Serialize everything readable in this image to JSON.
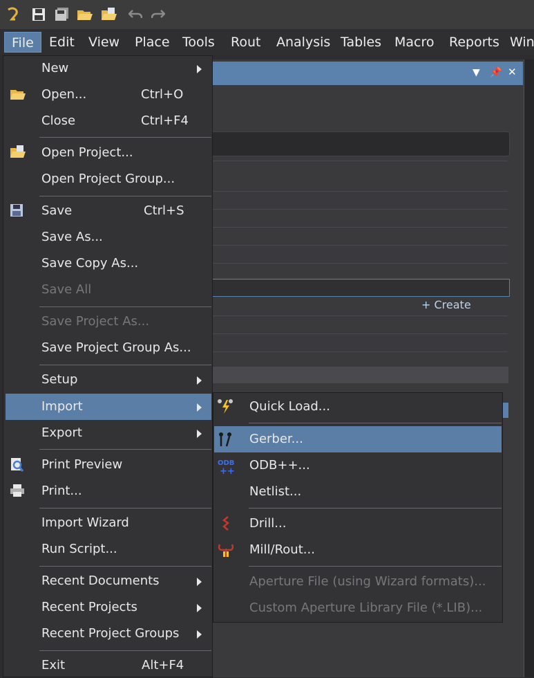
{
  "menubar": {
    "items": [
      "File",
      "Edit",
      "View",
      "Place",
      "Tools",
      "Rout",
      "Analysis",
      "Tables",
      "Macro",
      "Reports",
      "Win"
    ]
  },
  "panel": {
    "create_label": "+ Create"
  },
  "file_menu": {
    "new": "New",
    "open": "Open...",
    "open_sc": "Ctrl+O",
    "close": "Close",
    "close_sc": "Ctrl+F4",
    "open_project": "Open Project...",
    "open_project_group": "Open Project Group...",
    "save": "Save",
    "save_sc": "Ctrl+S",
    "save_as": "Save As...",
    "save_copy_as": "Save Copy As...",
    "save_all": "Save All",
    "save_project_as": "Save Project As...",
    "save_project_group_as": "Save Project Group As...",
    "setup": "Setup",
    "import": "Import",
    "export": "Export",
    "print_preview": "Print Preview",
    "print": "Print...",
    "import_wizard": "Import Wizard",
    "run_script": "Run Script...",
    "recent_documents": "Recent Documents",
    "recent_projects": "Recent Projects",
    "recent_project_groups": "Recent Project Groups",
    "exit": "Exit",
    "exit_sc": "Alt+F4"
  },
  "import_menu": {
    "quick_load": "Quick Load...",
    "gerber": "Gerber...",
    "odb": "ODB++...",
    "netlist": "Netlist...",
    "drill": "Drill...",
    "mill_rout": "Mill/Rout...",
    "aperture_file": "Aperture File (using Wizard formats)...",
    "custom_aperture": "Custom Aperture Library File (*.LIB)..."
  },
  "colors": {
    "highlight": "#5a7ea5",
    "menu_bg": "#333336",
    "disabled_text": "#77777a"
  }
}
